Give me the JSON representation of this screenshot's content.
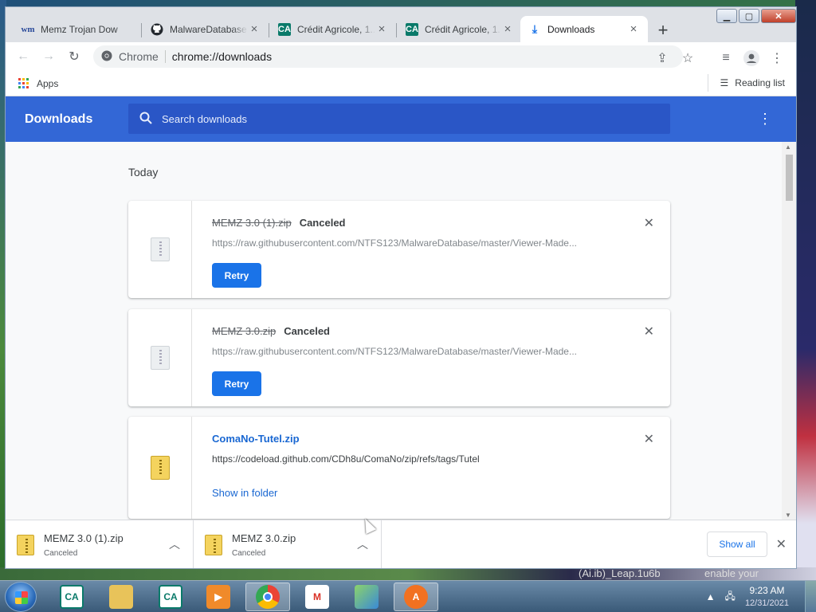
{
  "desktop": {
    "peek_text_1": "(Ai.ib)_Leap.1u6b",
    "peek_text_2": "enable your"
  },
  "tabs": [
    {
      "title": "Memz Trojan Dow",
      "icon": "wm-favicon",
      "active": false
    },
    {
      "title": "MalwareDatabase",
      "icon": "github-icon",
      "active": false
    },
    {
      "title": "Crédit Agricole, 1...",
      "icon": "credit-agricole-icon",
      "active": false
    },
    {
      "title": "Crédit Agricole, 1...",
      "icon": "credit-agricole-icon",
      "active": false
    },
    {
      "title": "Downloads",
      "icon": "download-icon",
      "active": true
    }
  ],
  "omnibox": {
    "site": "Chrome",
    "url": "chrome://downloads"
  },
  "bookmarks": {
    "apps_label": "Apps",
    "reading_list_label": "Reading list"
  },
  "header": {
    "title": "Downloads",
    "search_placeholder": "Search downloads"
  },
  "section_label": "Today",
  "downloads": [
    {
      "name": "MEMZ 3.0 (1).zip",
      "status": "Canceled",
      "url": "https://raw.githubusercontent.com/NTFS123/MalwareDatabase/master/Viewer-Made...",
      "action": "Retry"
    },
    {
      "name": "MEMZ 3.0.zip",
      "status": "Canceled",
      "url": "https://raw.githubusercontent.com/NTFS123/MalwareDatabase/master/Viewer-Made...",
      "action": "Retry"
    },
    {
      "name": "ComaNo-Tutel.zip",
      "status": "",
      "url": "https://codeload.github.com/CDh8u/ComaNo/zip/refs/tags/Tutel",
      "action": "Show in folder"
    }
  ],
  "shelf": {
    "items": [
      {
        "name": "MEMZ 3.0 (1).zip",
        "status": "Canceled"
      },
      {
        "name": "MEMZ 3.0.zip",
        "status": "Canceled"
      }
    ],
    "show_all": "Show all"
  },
  "taskbar": {
    "time": "9:23 AM",
    "date": "12/31/2021"
  },
  "colors": {
    "accent": "#3367d6",
    "search_bg": "#2a56c6",
    "link": "#1967d2",
    "button": "#1a73e8"
  }
}
